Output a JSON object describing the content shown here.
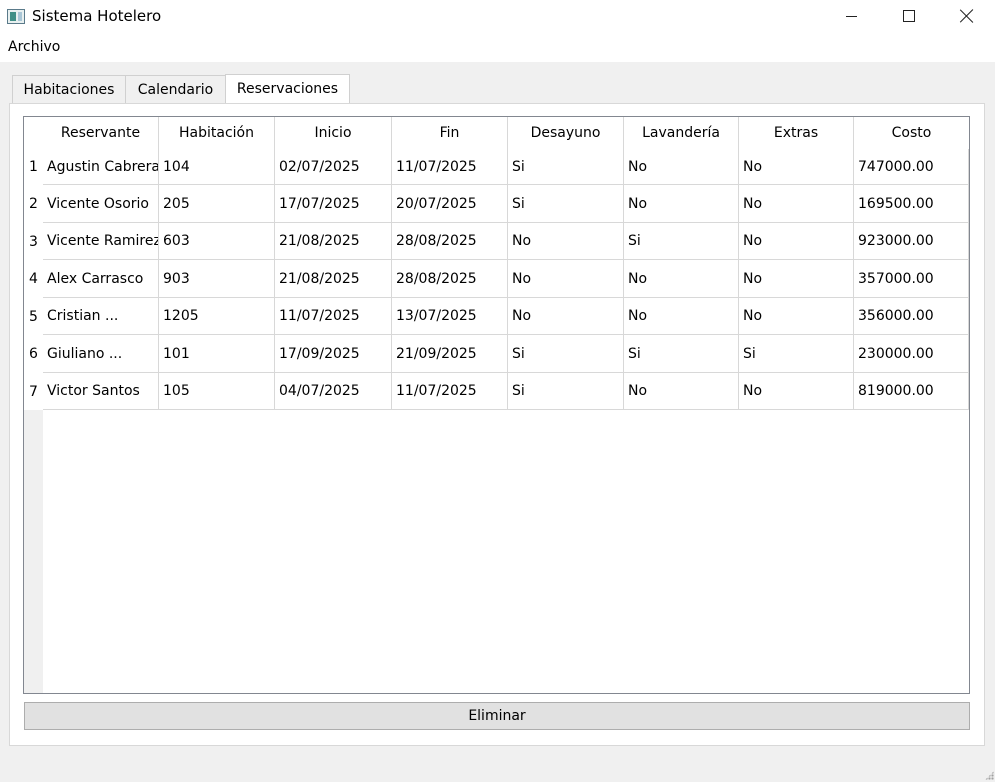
{
  "window": {
    "title": "Sistema Hotelero",
    "icon": "window-app-icon",
    "controls": [
      "minimize-icon",
      "maximize-icon",
      "close-icon"
    ]
  },
  "menu": {
    "archivo": "Archivo"
  },
  "tabs": [
    {
      "label": "Habitaciones",
      "active": false
    },
    {
      "label": "Calendario",
      "active": false
    },
    {
      "label": "Reservaciones",
      "active": true
    }
  ],
  "table": {
    "headers": [
      "Reservante",
      "Habitación",
      "Inicio",
      "Fin",
      "Desayuno",
      "Lavandería",
      "Extras",
      "Costo"
    ],
    "rows": [
      {
        "num": "1",
        "cells": [
          "Agustin Cabrera",
          "104",
          "02/07/2025",
          "11/07/2025",
          "Si",
          "No",
          "No",
          "747000.00"
        ]
      },
      {
        "num": "2",
        "cells": [
          "Vicente Osorio",
          "205",
          "17/07/2025",
          "20/07/2025",
          "Si",
          "No",
          "No",
          "169500.00"
        ]
      },
      {
        "num": "3",
        "cells": [
          "Vicente Ramirez",
          "603",
          "21/08/2025",
          "28/08/2025",
          "No",
          "Si",
          "No",
          "923000.00"
        ]
      },
      {
        "num": "4",
        "cells": [
          "Alex Carrasco",
          "903",
          "21/08/2025",
          "28/08/2025",
          "No",
          "No",
          "No",
          "357000.00"
        ]
      },
      {
        "num": "5",
        "cells": [
          "Cristian ...",
          "1205",
          "11/07/2025",
          "13/07/2025",
          "No",
          "No",
          "No",
          "356000.00"
        ]
      },
      {
        "num": "6",
        "cells": [
          "Giuliano ...",
          "101",
          "17/09/2025",
          "21/09/2025",
          "Si",
          "Si",
          "Si",
          "230000.00"
        ]
      },
      {
        "num": "7",
        "cells": [
          "Victor Santos",
          "105",
          "04/07/2025",
          "11/07/2025",
          "Si",
          "No",
          "No",
          "819000.00"
        ]
      }
    ]
  },
  "actions": {
    "eliminar": "Eliminar"
  },
  "colors": {
    "window_bg": "#f0f0f0",
    "pane_bg": "#ffffff",
    "grid_line": "#d8d8d8",
    "button_bg": "#e1e1e1"
  }
}
